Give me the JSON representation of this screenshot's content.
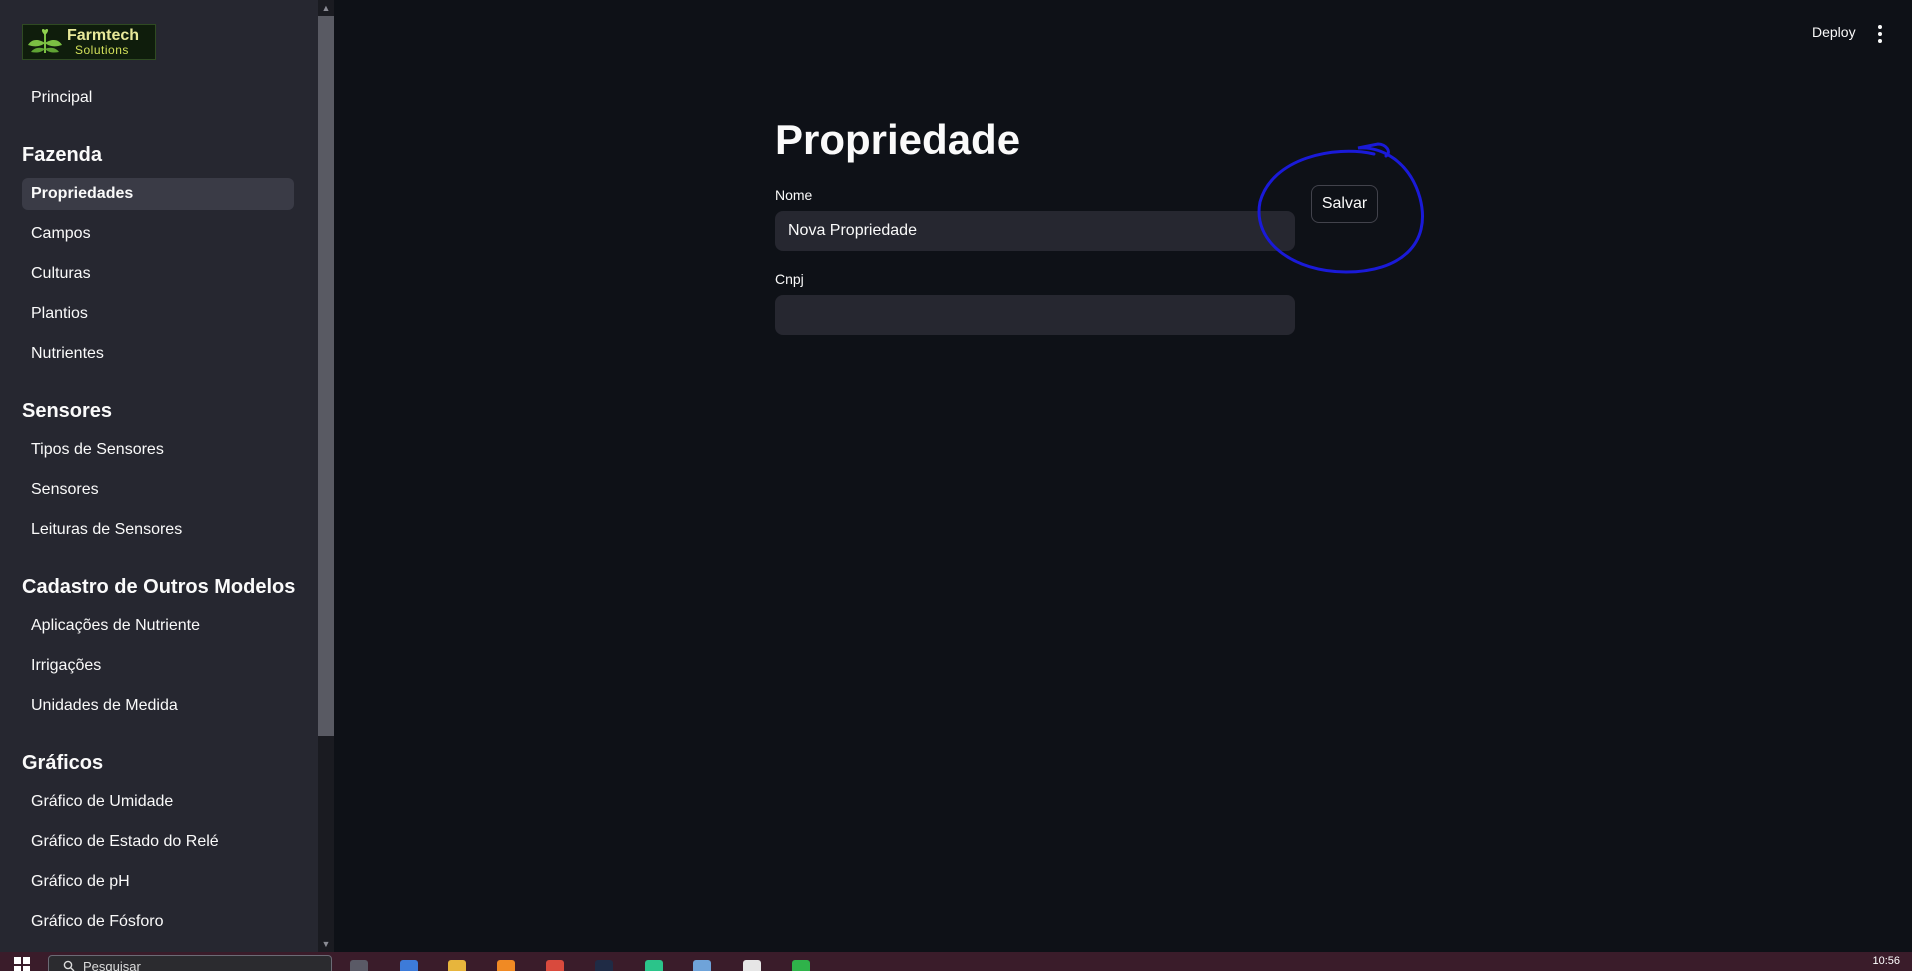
{
  "app": {
    "logo_line1": "Farmtech",
    "logo_line2": "Solutions",
    "deploy_label": "Deploy"
  },
  "sidebar": {
    "principal": "Principal",
    "sections": [
      {
        "heading": "Fazenda",
        "items": [
          "Propriedades",
          "Campos",
          "Culturas",
          "Plantios",
          "Nutrientes"
        ]
      },
      {
        "heading": "Sensores",
        "items": [
          "Tipos de Sensores",
          "Sensores",
          "Leituras de Sensores"
        ]
      },
      {
        "heading": "Cadastro de Outros Modelos",
        "items": [
          "Aplicações de Nutriente",
          "Irrigações",
          "Unidades de Medida"
        ]
      },
      {
        "heading": "Gráficos",
        "items": [
          "Gráfico de Umidade",
          "Gráfico de Estado do Relé",
          "Gráfico de pH",
          "Gráfico de Fósforo"
        ]
      }
    ],
    "active_item": "Propriedades"
  },
  "main": {
    "title": "Propriedade",
    "nome_label": "Nome",
    "nome_value": "Nova Propriedade",
    "cnpj_label": "Cnpj",
    "cnpj_value": "",
    "save_label": "Salvar",
    "annotation_color": "#1a1ad8"
  },
  "taskbar": {
    "search_placeholder": "Pesquisar",
    "clock": "10:56",
    "app_icons": [
      "taskview-icon",
      "copilot-icon",
      "file-explorer-icon",
      "firefox-icon",
      "chrome-icon",
      "steam-icon",
      "pycharm-icon",
      "photos-icon",
      "terminal-icon",
      "spreadsheet-icon"
    ]
  }
}
